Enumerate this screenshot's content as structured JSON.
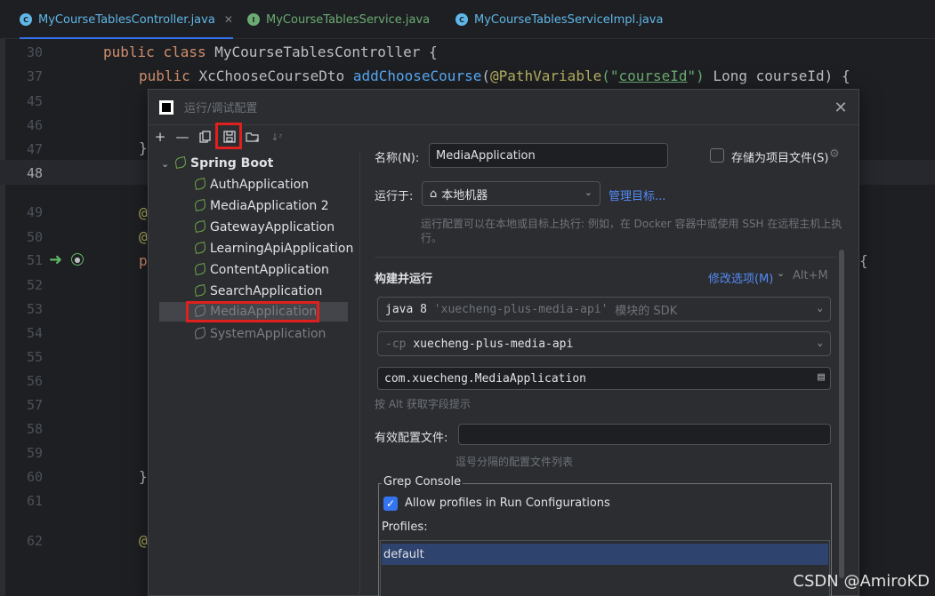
{
  "tabs": [
    {
      "label": "MyCourseTablesController.java",
      "icon": "class-icon",
      "color": "#5fb7e8",
      "active": true
    },
    {
      "label": "MyCourseTablesService.java",
      "icon": "interface-icon",
      "color": "#6aab73",
      "active": false
    },
    {
      "label": "MyCourseTablesServiceImpl.java",
      "icon": "class-icon",
      "color": "#5fb7e8",
      "active": false
    }
  ],
  "editor": {
    "line_numbers": [
      "30",
      "37",
      "45",
      "46",
      "47",
      "48",
      "49",
      "50",
      "51",
      "52",
      "53",
      "54",
      "55",
      "56",
      "57",
      "58",
      "59",
      "60",
      "61",
      "62"
    ],
    "line30": {
      "kw1": "public",
      "kw2": "class",
      "name": "MyCourseTablesController",
      "brace": "{"
    },
    "line37": {
      "kw1": "public",
      "type": "XcChooseCourseDto",
      "method": "addChooseCourse",
      "ann": "@PathVariable",
      "str_open": "(\"",
      "str_val": "courseId",
      "str_close": "\")",
      "rest": " Long courseId) {"
    },
    "line47": "}",
    "line49": "@",
    "line50": "@",
    "line51": "p",
    "line51_tail": "{",
    "line60": "}",
    "line62": "@"
  },
  "dialog": {
    "title": "运行/调试配置",
    "tree": {
      "group": "Spring Boot",
      "items": [
        {
          "label": "AuthApplication",
          "selected": false,
          "grey": false
        },
        {
          "label": "MediaApplication 2",
          "selected": false,
          "grey": false
        },
        {
          "label": "GatewayApplication",
          "selected": false,
          "grey": false
        },
        {
          "label": "LearningApiApplication",
          "selected": false,
          "grey": false
        },
        {
          "label": "ContentApplication",
          "selected": false,
          "grey": false
        },
        {
          "label": "SearchApplication",
          "selected": false,
          "grey": false
        },
        {
          "label": "MediaApplication",
          "selected": true,
          "grey": true
        },
        {
          "label": "SystemApplication",
          "selected": false,
          "grey": true
        }
      ]
    },
    "form": {
      "name_label": "名称(N):",
      "name_value": "MediaApplication",
      "store_label": "存储为项目文件(S)",
      "run_on_label": "运行于:",
      "run_on_value": "本地机器",
      "manage_targets": "管理目标...",
      "run_hint": "运行配置可以在本地或目标上执行: 例如，在 Docker 容器中或使用 SSH 在远程主机上执行。",
      "build_run": "构建并运行",
      "modify_options": "修改选项(M)",
      "modify_shortcut": "Alt+M",
      "sdk_value_prefix": "java 8",
      "sdk_value_module": "'xuecheng-plus-media-api'",
      "sdk_value_suffix": "模块的 SDK",
      "cp_flag": "-cp",
      "cp_value": "xuecheng-plus-media-api",
      "main_class": "com.xuecheng.MediaApplication",
      "alt_hint": "按 Alt 获取字段提示",
      "profiles_label": "有效配置文件:",
      "profiles_value": "",
      "profiles_hint": "逗号分隔的配置文件列表",
      "grep_title": "Grep Console",
      "allow_profiles": "Allow profiles in Run Configurations",
      "profiles_list_label": "Profiles:",
      "profile_item": "default"
    }
  },
  "watermark": "CSDN @AmiroKD"
}
